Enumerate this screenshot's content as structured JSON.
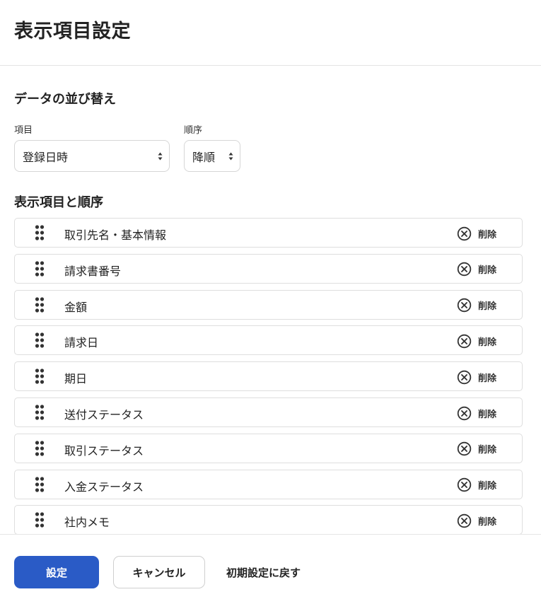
{
  "dialog": {
    "title": "表示項目設定"
  },
  "sort": {
    "section_title": "データの並び替え",
    "item_label": "項目",
    "item_value": "登録日時",
    "order_label": "順序",
    "order_value": "降順"
  },
  "columns": {
    "section_title": "表示項目と順序",
    "delete_label": "削除",
    "items": [
      {
        "label": "取引先名・基本情報"
      },
      {
        "label": "請求書番号"
      },
      {
        "label": "金額"
      },
      {
        "label": "請求日"
      },
      {
        "label": "期日"
      },
      {
        "label": "送付ステータス"
      },
      {
        "label": "取引ステータス"
      },
      {
        "label": "入金ステータス"
      },
      {
        "label": "社内メモ"
      }
    ]
  },
  "footer": {
    "submit_label": "設定",
    "cancel_label": "キャンセル",
    "reset_label": "初期設定に戻す"
  },
  "colors": {
    "primary": "#2a5bc6",
    "border": "#dedede",
    "text": "#222222"
  }
}
